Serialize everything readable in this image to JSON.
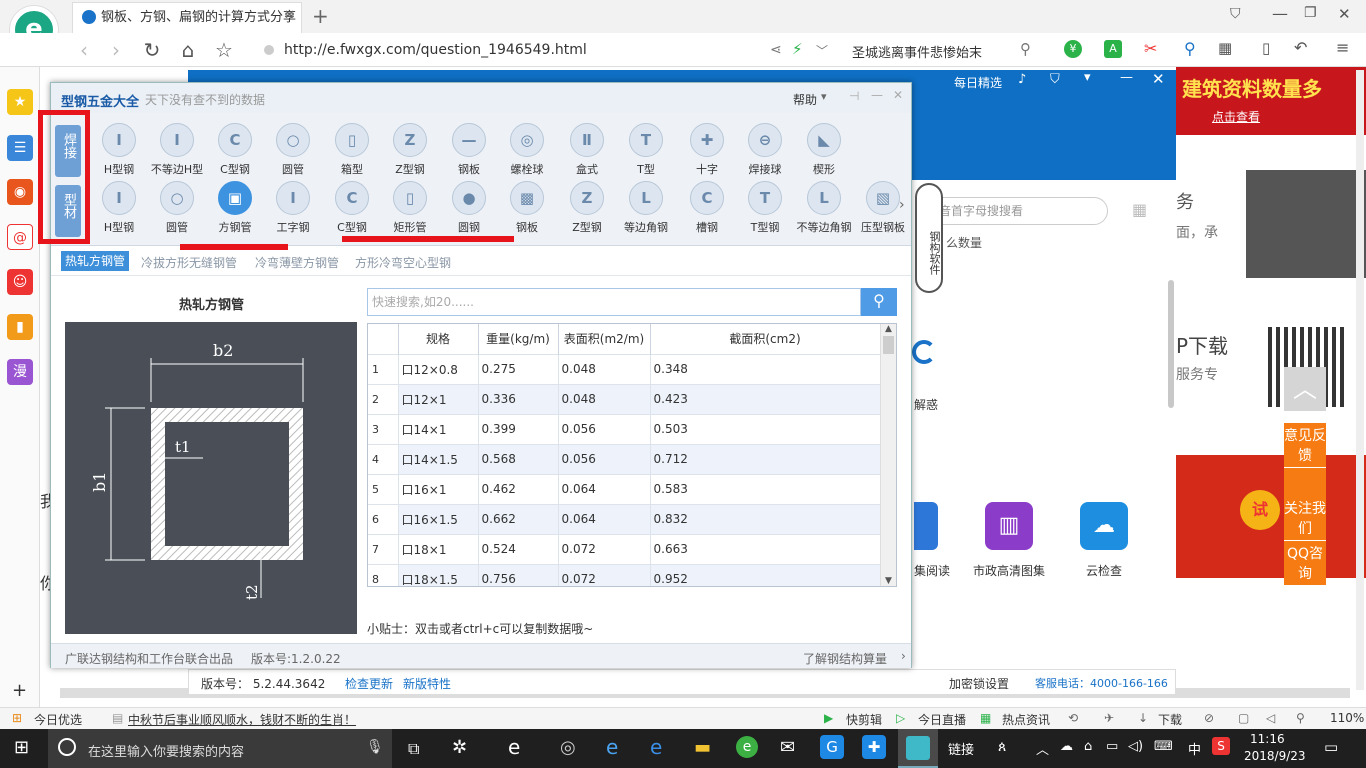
{
  "browser": {
    "tab_title": "钢板、方钢、扁钢的计算方式分享",
    "url": "http://e.fwxgx.com/question_1946549.html",
    "search_text": "圣城逃离事件悲惨始末",
    "new_tab": "+"
  },
  "bg": {
    "daily": "每日精选",
    "banner1": "建筑资料数量多",
    "banner1_sub": "点击查看",
    "search_placeholder": "拼音首字母搜搜看",
    "dl": "P下载",
    "service": "服务专",
    "float": [
      "意见反馈",
      "关注我们",
      "QQ咨询"
    ],
    "apps": [
      "集阅读",
      "市政高清图集",
      "云检查"
    ],
    "jiehuo": "解惑",
    "wu": "务",
    "mian": "面，承",
    "shuliang": "么数量",
    "left_chars": [
      "我",
      "你"
    ],
    "version": "版本号： 5.2.44.3642",
    "check_update": "检查更新",
    "new_features": "新版特性",
    "lock": "加密锁设置",
    "hotline": "客服电话：4000-166-166"
  },
  "app": {
    "title": "型钢五金大全",
    "subtitle": "天下没有查不到的数据",
    "help": "帮助",
    "left_tags": [
      "焊接",
      "型材"
    ],
    "row1": [
      "H型钢",
      "不等边H型",
      "C型钢",
      "圆管",
      "箱型",
      "Z型钢",
      "钢板",
      "螺栓球",
      "盒式",
      "T型",
      "十字",
      "焊接球",
      "楔形"
    ],
    "row2": [
      "H型钢",
      "圆管",
      "方钢管",
      "工字钢",
      "C型钢",
      "矩形管",
      "圆钢",
      "钢板",
      "Z型钢",
      "等边角钢",
      "槽钢",
      "T型钢",
      "不等边角钢",
      "压型钢板"
    ],
    "mascot": "钢构软件",
    "subtabs": [
      "热轧方钢管",
      "冷拔方形无缝钢管",
      "冷弯薄壁方钢管",
      "方形冷弯空心型钢"
    ],
    "diagram_title": "热轧方钢管",
    "dims": {
      "b2": "b2",
      "b1": "b1",
      "t1": "t1",
      "t2": "t2"
    },
    "search_placeholder": "快速搜索,如20......",
    "headers": [
      "规格",
      "重量(kg/m)",
      "表面积(m2/m)",
      "截面积(cm2)"
    ],
    "rows": [
      [
        "1",
        "口12×0.8",
        "0.275",
        "0.048",
        "0.348"
      ],
      [
        "2",
        "口12×1",
        "0.336",
        "0.048",
        "0.423"
      ],
      [
        "3",
        "口14×1",
        "0.399",
        "0.056",
        "0.503"
      ],
      [
        "4",
        "口14×1.5",
        "0.568",
        "0.056",
        "0.712"
      ],
      [
        "5",
        "口16×1",
        "0.462",
        "0.064",
        "0.583"
      ],
      [
        "6",
        "口16×1.5",
        "0.662",
        "0.064",
        "0.832"
      ],
      [
        "7",
        "口18×1",
        "0.524",
        "0.072",
        "0.663"
      ],
      [
        "8",
        "口18×1.5",
        "0.756",
        "0.072",
        "0.952"
      ]
    ],
    "tip": "小贴士：双击或者ctrl+c可以复制数据哦~",
    "footer_left": "广联达钢结构和工作台联合出品",
    "footer_version": "版本号:1.2.0.22",
    "footer_right": "了解钢结构算量"
  },
  "bstatus": {
    "today": "今日优选",
    "news": "中秋节后事业顺风顺水，钱财不断的生肖！",
    "kuai": "快剪辑",
    "live": "今日直播",
    "hot": "热点资讯",
    "download": "下载",
    "zoom": "110%"
  },
  "taskbar": {
    "search": "在这里输入你要搜索的内容",
    "link": "链接",
    "ime": "中",
    "time": "11:16",
    "date": "2018/9/23"
  }
}
